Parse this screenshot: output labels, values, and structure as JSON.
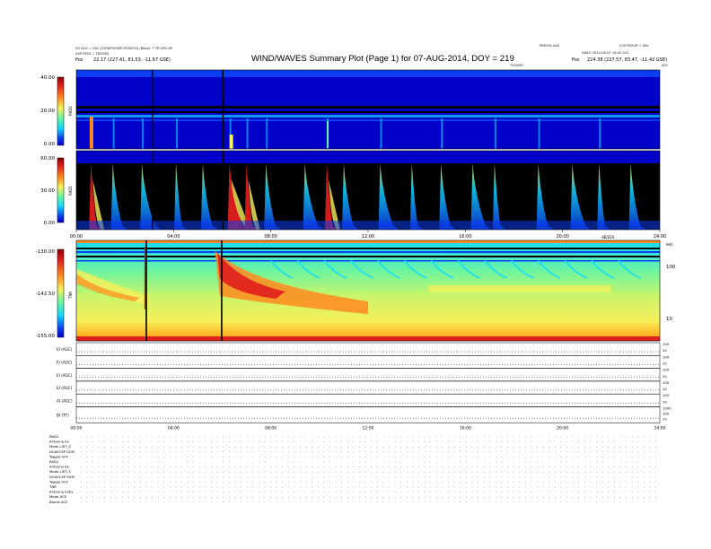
{
  "header": {
    "left_line1": "SO DLD = SAC [OSTAPSOSSP:POSSOO] (8bby): T FR ORG:SP",
    "left_line2": "ASP PSS3 = 7DSOSS",
    "left_line3": "22.17 (227.41, 81.53, -11.67 GSE)",
    "left_line3_prefix": "Pos",
    "right_line1": "PKRIOD AAS",
    "right_line1b": "LOS PXOUR = SAC",
    "right_line2": "DAILY: 2014-08-07 14:00 SCS",
    "right_line3": "224.38 (227.57, 83.47, -11.42 GSE)",
    "right_line3_prefix": "Pos",
    "center_small": "TSSUMS",
    "top_right_small": "SS2"
  },
  "title": "WIND/WAVES Summary Plot (Page 1) for 07-AUG-2014, DOY = 219",
  "colors": {
    "deep_blue": "#0000c8",
    "mid_blue": "#0a3cf0",
    "cyan": "#12d8ff",
    "green": "#6cf5a0",
    "yellow": "#f7f05a",
    "orange": "#ff8a1e",
    "red": "#e01e1e",
    "dark_red": "#8a0000",
    "black": "#000000"
  },
  "chart_data": [
    {
      "type": "heatmap",
      "panel": "RAD2",
      "ylabel": "RAD2",
      "colorbar_ticks": [
        "40.00",
        "20.00",
        "0.00"
      ],
      "ylim": [
        0,
        40
      ],
      "x_hours": [
        0,
        24
      ],
      "bursts_hours": [
        0.6,
        1.5,
        2.7,
        4.1,
        6.3,
        7.0,
        7.8,
        10.3,
        12.5,
        15.0,
        17.2,
        19.0,
        21.5
      ],
      "vertical_gaps_hours": [
        3.1,
        6.0
      ]
    },
    {
      "type": "heatmap",
      "panel": "RAD1",
      "ylabel": "RAD1",
      "colorbar_ticks": [
        "60.00",
        "30.00",
        "0.00"
      ],
      "ylim": [
        0,
        60
      ],
      "x_ticks": [
        "00:00",
        "04:00",
        "08:00",
        "12:00",
        "16:00",
        "20:00",
        "24:00"
      ],
      "bursts_hours": [
        0.6,
        1.5,
        2.7,
        4.1,
        5.2,
        6.3,
        7.0,
        7.8,
        9.4,
        10.3,
        11.0,
        12.5,
        13.8,
        15.0,
        16.3,
        17.2,
        19.0,
        20.4,
        21.5,
        22.8
      ],
      "vertical_gaps_hours": [
        3.1,
        6.0
      ]
    },
    {
      "type": "heatmap",
      "panel": "TNR",
      "ylabel": "TNR",
      "colorbar_ticks": [
        "-130.00",
        "-142.50",
        "-155.00"
      ],
      "zlim": [
        -155,
        -130
      ],
      "right_axis_ticks": [
        "100",
        "10"
      ],
      "right_axis_label": "kHz",
      "top_right_label": "dB/ESX",
      "vertical_lines_hours": [
        2.85,
        5.95
      ]
    },
    {
      "type": "line",
      "panel": "housekeeping",
      "rows": [
        {
          "label": "EI (AGC)",
          "ticks": [
            "100",
            "10"
          ]
        },
        {
          "label": "EI (AGC)",
          "ticks": [
            "100",
            "10"
          ]
        },
        {
          "label": "EI (AGC)",
          "ticks": [
            "100",
            "10"
          ]
        },
        {
          "label": "EI (AGC)",
          "ticks": [
            "100",
            "10"
          ]
        },
        {
          "label": "AI (AGC)",
          "ticks": [
            "100",
            "10"
          ]
        },
        {
          "label": "BI (TT)",
          "ticks": [
            "1000",
            "100",
            "10"
          ]
        }
      ],
      "x_ticks": [
        "00:00",
        "04:00",
        "08:00",
        "12:00",
        "16:00",
        "20:00",
        "24:00"
      ]
    }
  ],
  "bottom_text": {
    "block1": [
      "RAD2",
      "Antenna   Ex",
      "Mode   LIST_S",
      "DUASCSP SUM",
      "Toggle   OFF"
    ],
    "block2": [
      "RAD1",
      "Antenna   Ex",
      "Mode   LIST_S",
      "DUASCSP SUM",
      "Toggle   OFF"
    ],
    "block3": [
      "TNR",
      "Antenna   ExEy",
      "Mode   ACE",
      "Bands   ACE"
    ]
  }
}
